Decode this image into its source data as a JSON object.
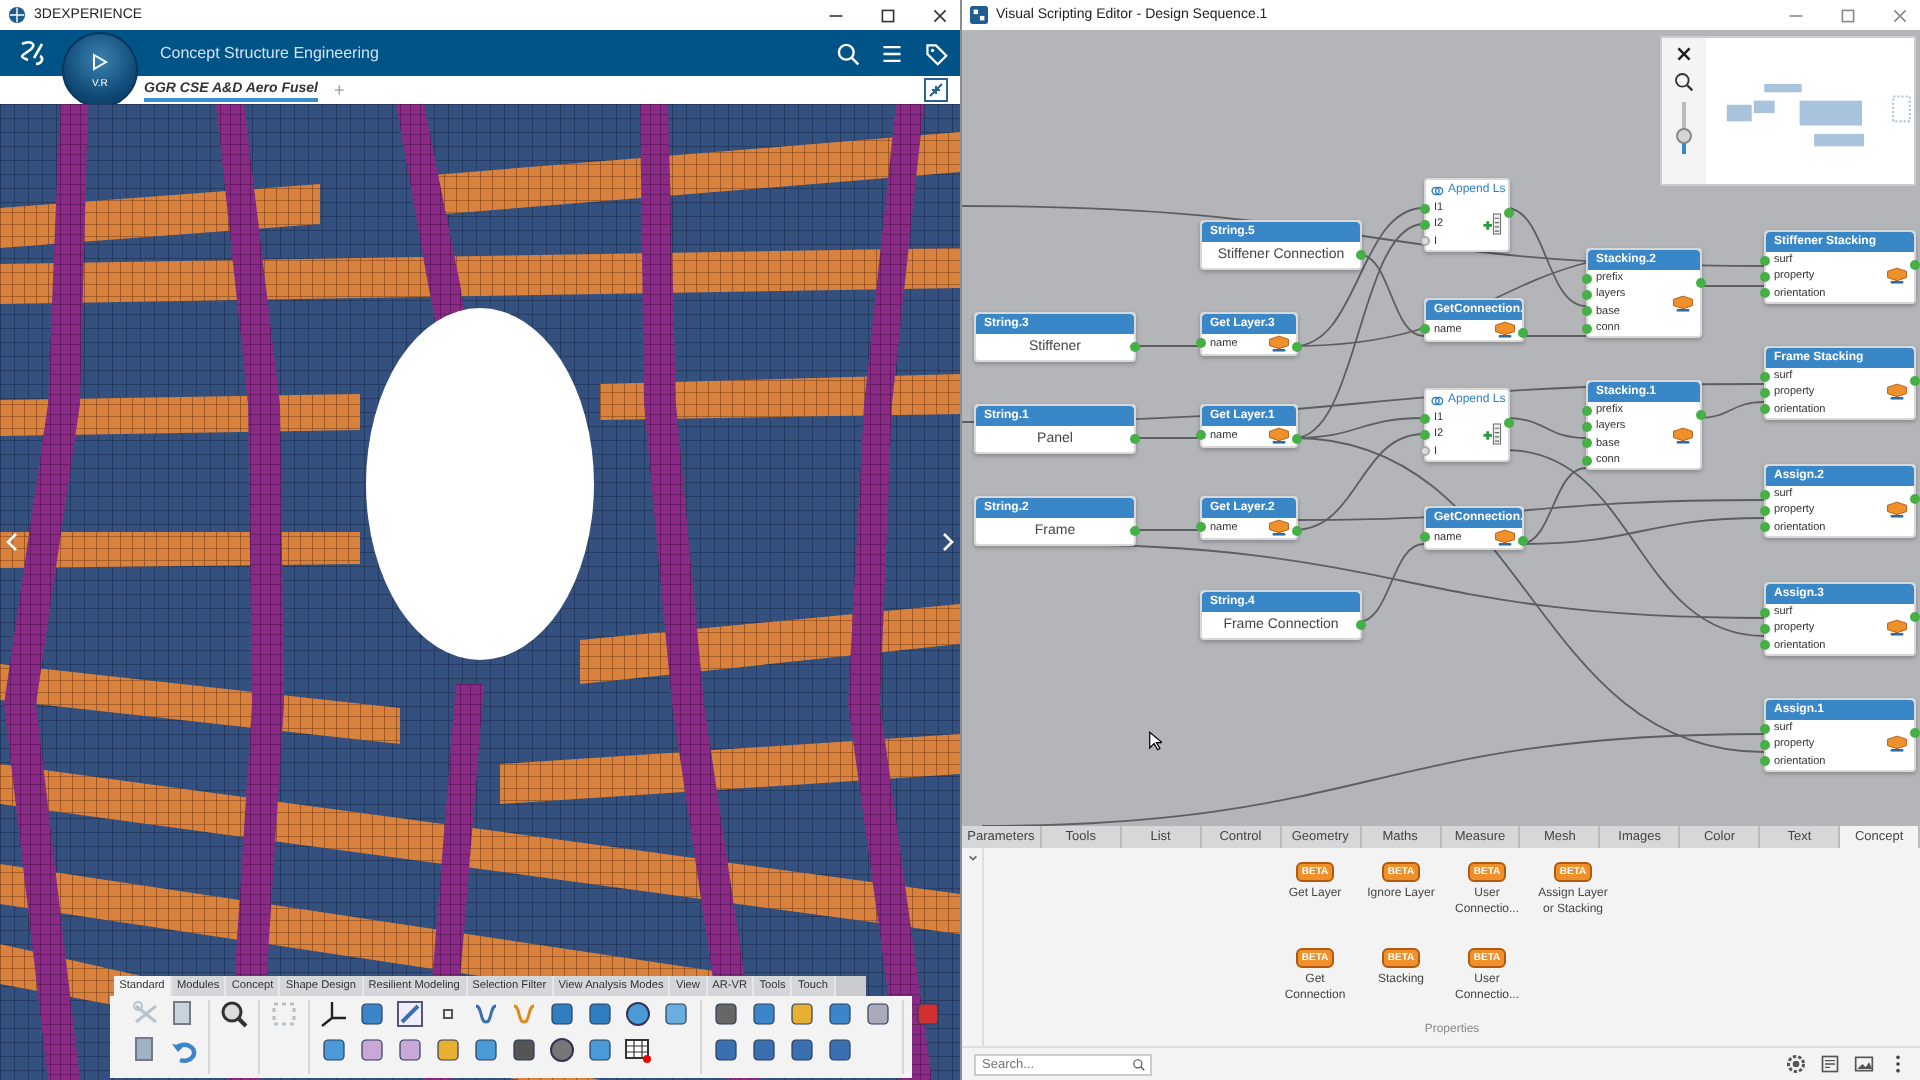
{
  "left_window": {
    "title": "3DEXPERIENCE",
    "app_name": "Concept Structure Engineering",
    "compass_label": "V.R",
    "tabs": [
      {
        "label": "GGR CSE A&D Aero Fusel",
        "selected": true
      }
    ],
    "add_tab": "+",
    "toolbar": {
      "tabs": [
        {
          "label": "Standard",
          "selected": true
        },
        {
          "label": "Modules",
          "selected": false
        },
        {
          "label": "Concept",
          "selected": false
        },
        {
          "label": "Shape Design",
          "selected": false
        },
        {
          "label": "Resilient Modeling",
          "selected": false
        },
        {
          "label": "Selection Filter",
          "selected": false
        },
        {
          "label": "View Analysis Modes",
          "selected": false
        },
        {
          "label": "View",
          "selected": false
        },
        {
          "label": "AR-VR",
          "selected": false
        },
        {
          "label": "Tools",
          "selected": false
        },
        {
          "label": "Touch",
          "selected": false
        }
      ]
    }
  },
  "right_window": {
    "title": "Visual Scripting Editor - Design Sequence.1",
    "minimap": {
      "zoom_slider": {
        "level": 0.35
      }
    },
    "nodes": [
      {
        "kind": "value",
        "title": "String.3",
        "value": "Stiffener"
      },
      {
        "kind": "value",
        "title": "String.1",
        "value": "Panel"
      },
      {
        "kind": "value",
        "title": "String.2",
        "value": "Frame"
      },
      {
        "kind": "value",
        "title": "String.5",
        "value": "Stiffener Connection"
      },
      {
        "kind": "function",
        "title": "Get Layer.3",
        "ports": [
          {
            "label": "name",
            "connected": true
          }
        ]
      },
      {
        "kind": "function",
        "title": "Get Layer.1",
        "ports": [
          {
            "label": "name",
            "connected": true
          }
        ]
      },
      {
        "kind": "function",
        "title": "Get Layer.2",
        "ports": [
          {
            "label": "name",
            "connected": true
          }
        ]
      },
      {
        "kind": "value",
        "title": "String.4",
        "value": "Frame Connection"
      },
      {
        "kind": "list",
        "title": "Append Ls",
        "ports": [
          {
            "label": "I1",
            "connected": true
          },
          {
            "label": "I2",
            "connected": true
          },
          {
            "label": "I",
            "connected": false
          }
        ]
      },
      {
        "kind": "function",
        "title": "GetConnection.",
        "ports": [
          {
            "label": "name",
            "connected": true
          }
        ]
      },
      {
        "kind": "list",
        "title": "Append Ls",
        "ports": [
          {
            "label": "I1",
            "connected": true
          },
          {
            "label": "I2",
            "connected": true
          },
          {
            "label": "I",
            "connected": false
          }
        ]
      },
      {
        "kind": "function",
        "title": "GetConnection.",
        "ports": [
          {
            "label": "name",
            "connected": true
          }
        ]
      },
      {
        "kind": "function",
        "title": "Stacking.2",
        "ports": [
          {
            "label": "prefix",
            "connected": true
          },
          {
            "label": "layers",
            "connected": true
          },
          {
            "label": "base",
            "connected": true
          },
          {
            "label": "conn",
            "connected": true
          }
        ]
      },
      {
        "kind": "function",
        "title": "Stacking.1",
        "ports": [
          {
            "label": "prefix",
            "connected": true
          },
          {
            "label": "layers",
            "connected": true
          },
          {
            "label": "base",
            "connected": true
          },
          {
            "label": "conn",
            "connected": true
          }
        ]
      },
      {
        "kind": "function",
        "title": "Stiffener Stacking",
        "ports": [
          {
            "label": "surf",
            "connected": true
          },
          {
            "label": "property",
            "connected": true
          },
          {
            "label": "orientation",
            "connected": true
          }
        ]
      },
      {
        "kind": "function",
        "title": "Frame Stacking",
        "ports": [
          {
            "label": "surf",
            "connected": true
          },
          {
            "label": "property",
            "connected": true
          },
          {
            "label": "orientation",
            "connected": true
          }
        ]
      },
      {
        "kind": "function",
        "title": "Assign.2",
        "ports": [
          {
            "label": "surf",
            "connected": true
          },
          {
            "label": "property",
            "connected": true
          },
          {
            "label": "orientation",
            "connected": true
          }
        ]
      },
      {
        "kind": "function",
        "title": "Assign.3",
        "ports": [
          {
            "label": "surf",
            "connected": true
          },
          {
            "label": "property",
            "connected": true
          },
          {
            "label": "orientation",
            "connected": true
          }
        ]
      },
      {
        "kind": "function",
        "title": "Assign.1",
        "ports": [
          {
            "label": "surf",
            "connected": true
          },
          {
            "label": "property",
            "connected": true
          },
          {
            "label": "orientation",
            "connected": true
          }
        ]
      }
    ],
    "palette": {
      "tabs": [
        {
          "label": "Parameters",
          "selected": false
        },
        {
          "label": "Tools",
          "selected": false
        },
        {
          "label": "List",
          "selected": false
        },
        {
          "label": "Control",
          "selected": false
        },
        {
          "label": "Geometry",
          "selected": false
        },
        {
          "label": "Maths",
          "selected": false
        },
        {
          "label": "Measure",
          "selected": false
        },
        {
          "label": "Mesh",
          "selected": false
        },
        {
          "label": "Images",
          "selected": false
        },
        {
          "label": "Color",
          "selected": false
        },
        {
          "label": "Text",
          "selected": false
        },
        {
          "label": "Concept",
          "selected": true
        }
      ],
      "items": [
        {
          "label": "Get Layer",
          "badge": "BETA"
        },
        {
          "label": "Ignore Layer",
          "badge": "BETA"
        },
        {
          "label": "User Connectio...",
          "badge": "BETA"
        },
        {
          "label": "Assign Layer or Stacking",
          "badge": "BETA"
        },
        {
          "label": "Get Connection",
          "badge": "BETA"
        },
        {
          "label": "Stacking",
          "badge": "BETA"
        },
        {
          "label": "User Connectio...",
          "badge": "BETA"
        }
      ],
      "section": "Properties",
      "search": {
        "placeholder": "Search..."
      }
    }
  }
}
